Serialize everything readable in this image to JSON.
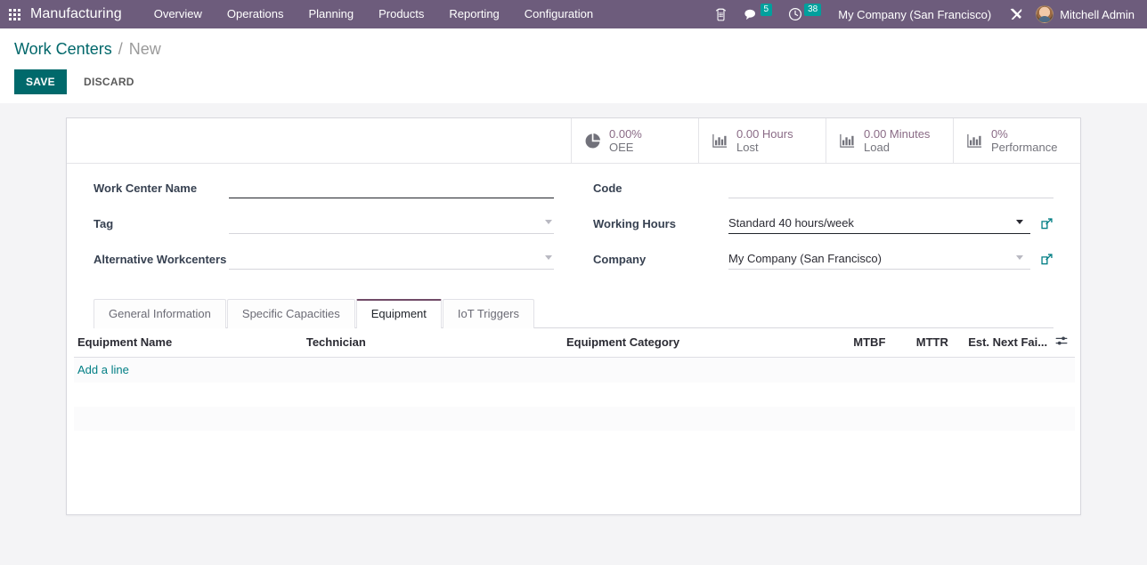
{
  "navbar": {
    "apps_icon": "apps-grid-icon",
    "brand": "Manufacturing",
    "menu": [
      {
        "label": "Overview"
      },
      {
        "label": "Operations"
      },
      {
        "label": "Planning"
      },
      {
        "label": "Products"
      },
      {
        "label": "Reporting"
      },
      {
        "label": "Configuration"
      }
    ],
    "icons": {
      "phone": "phone-icon",
      "chat": "chat-bubble-icon",
      "chat_badge": "5",
      "activity": "clock-icon",
      "activity_badge": "38",
      "tools": "tools-icon"
    },
    "company": "My Company (San Francisco)",
    "user": "Mitchell Admin",
    "colors": {
      "navbar_bg": "#6d5c7c",
      "badge_bg": "#00a09d",
      "accent_teal": "#017e84",
      "primary_purple": "#714b67"
    }
  },
  "control_panel": {
    "breadcrumb_root": "Work Centers",
    "breadcrumb_sep": "/",
    "breadcrumb_current": "New",
    "save_label": "SAVE",
    "discard_label": "DISCARD"
  },
  "stats": [
    {
      "icon": "pie-chart-icon",
      "value": "0.00%",
      "label": "OEE"
    },
    {
      "icon": "bar-chart-icon",
      "value": "0.00 Hours",
      "label": "Lost"
    },
    {
      "icon": "bar-chart-icon",
      "value": "0.00 Minutes",
      "label": "Load"
    },
    {
      "icon": "bar-chart-icon",
      "value": "0%",
      "label": "Performance"
    }
  ],
  "form": {
    "left": [
      {
        "label": "Work Center Name",
        "value": "",
        "placeholder": "",
        "type": "text",
        "required": true
      },
      {
        "label": "Tag",
        "value": "",
        "placeholder": "",
        "type": "many2many"
      },
      {
        "label": "Alternative Workcenters",
        "value": "",
        "placeholder": "",
        "type": "many2many"
      }
    ],
    "right": [
      {
        "label": "Code",
        "value": "",
        "placeholder": "",
        "type": "text"
      },
      {
        "label": "Working Hours",
        "value": "Standard 40 hours/week",
        "placeholder": "",
        "type": "many2one",
        "external_link": "external-link-icon"
      },
      {
        "label": "Company",
        "value": "My Company (San Francisco)",
        "placeholder": "",
        "type": "many2one",
        "external_link": "external-link-icon"
      }
    ]
  },
  "notebook": {
    "tabs": [
      {
        "label": "General Information",
        "active": false
      },
      {
        "label": "Specific Capacities",
        "active": false
      },
      {
        "label": "Equipment",
        "active": true
      },
      {
        "label": "IoT Triggers",
        "active": false
      }
    ]
  },
  "equipment_table": {
    "columns": [
      {
        "label": "Equipment Name",
        "align": "left"
      },
      {
        "label": "Technician",
        "align": "left"
      },
      {
        "label": "Equipment Category",
        "align": "left"
      },
      {
        "label": "MTBF",
        "align": "right"
      },
      {
        "label": "MTTR",
        "align": "right"
      },
      {
        "label": "Est. Next Fai...",
        "align": "right"
      }
    ],
    "rows": [],
    "add_line_label": "Add a line",
    "optional_columns_icon": "sliders-icon"
  }
}
